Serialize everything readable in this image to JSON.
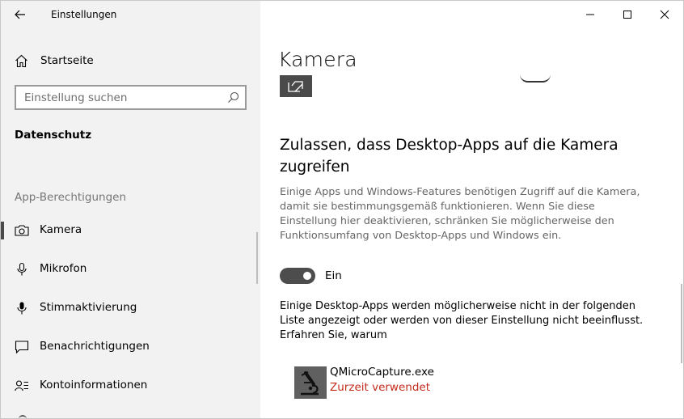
{
  "window": {
    "title": "Einstellungen"
  },
  "sidebar": {
    "home_label": "Startseite",
    "search_placeholder": "Einstellung suchen",
    "section_heading": "Datenschutz",
    "group_label": "App-Berechtigungen",
    "items": [
      {
        "label": "Kamera",
        "icon": "camera-icon",
        "selected": true
      },
      {
        "label": "Mikrofon",
        "icon": "microphone-icon",
        "selected": false
      },
      {
        "label": "Stimmaktivierung",
        "icon": "voice-activation-icon",
        "selected": false
      },
      {
        "label": "Benachrichtigungen",
        "icon": "notification-icon",
        "selected": false
      },
      {
        "label": "Kontoinformationen",
        "icon": "account-info-icon",
        "selected": false
      }
    ]
  },
  "main": {
    "page_title": "Kamera",
    "section_title": "Zulassen, dass Desktop-Apps auf die Kamera zugreifen",
    "description": "Einige Apps und Windows-Features benötigen Zugriff auf die Kamera, damit sie bestimmungsgemäß funktionieren. Wenn Sie diese Einstellung hier deaktivieren, schränken Sie möglicherweise den Funktionsumfang von Desktop-Apps und Windows ein.",
    "toggle": {
      "state": "on",
      "label": "Ein"
    },
    "note": "Einige Desktop-Apps werden möglicherweise nicht in der folgenden Liste angezeigt oder werden von dieser Einstellung nicht beeinflusst. Erfahren Sie, warum",
    "apps": [
      {
        "name": "QMicroCapture.exe",
        "status": "Zurzeit verwendet",
        "status_color": "#c42b1c"
      }
    ]
  },
  "colors": {
    "sidebar_bg": "#f2f2f2",
    "toggle_on": "#4d4d4d",
    "in_use": "#c42b1c"
  }
}
